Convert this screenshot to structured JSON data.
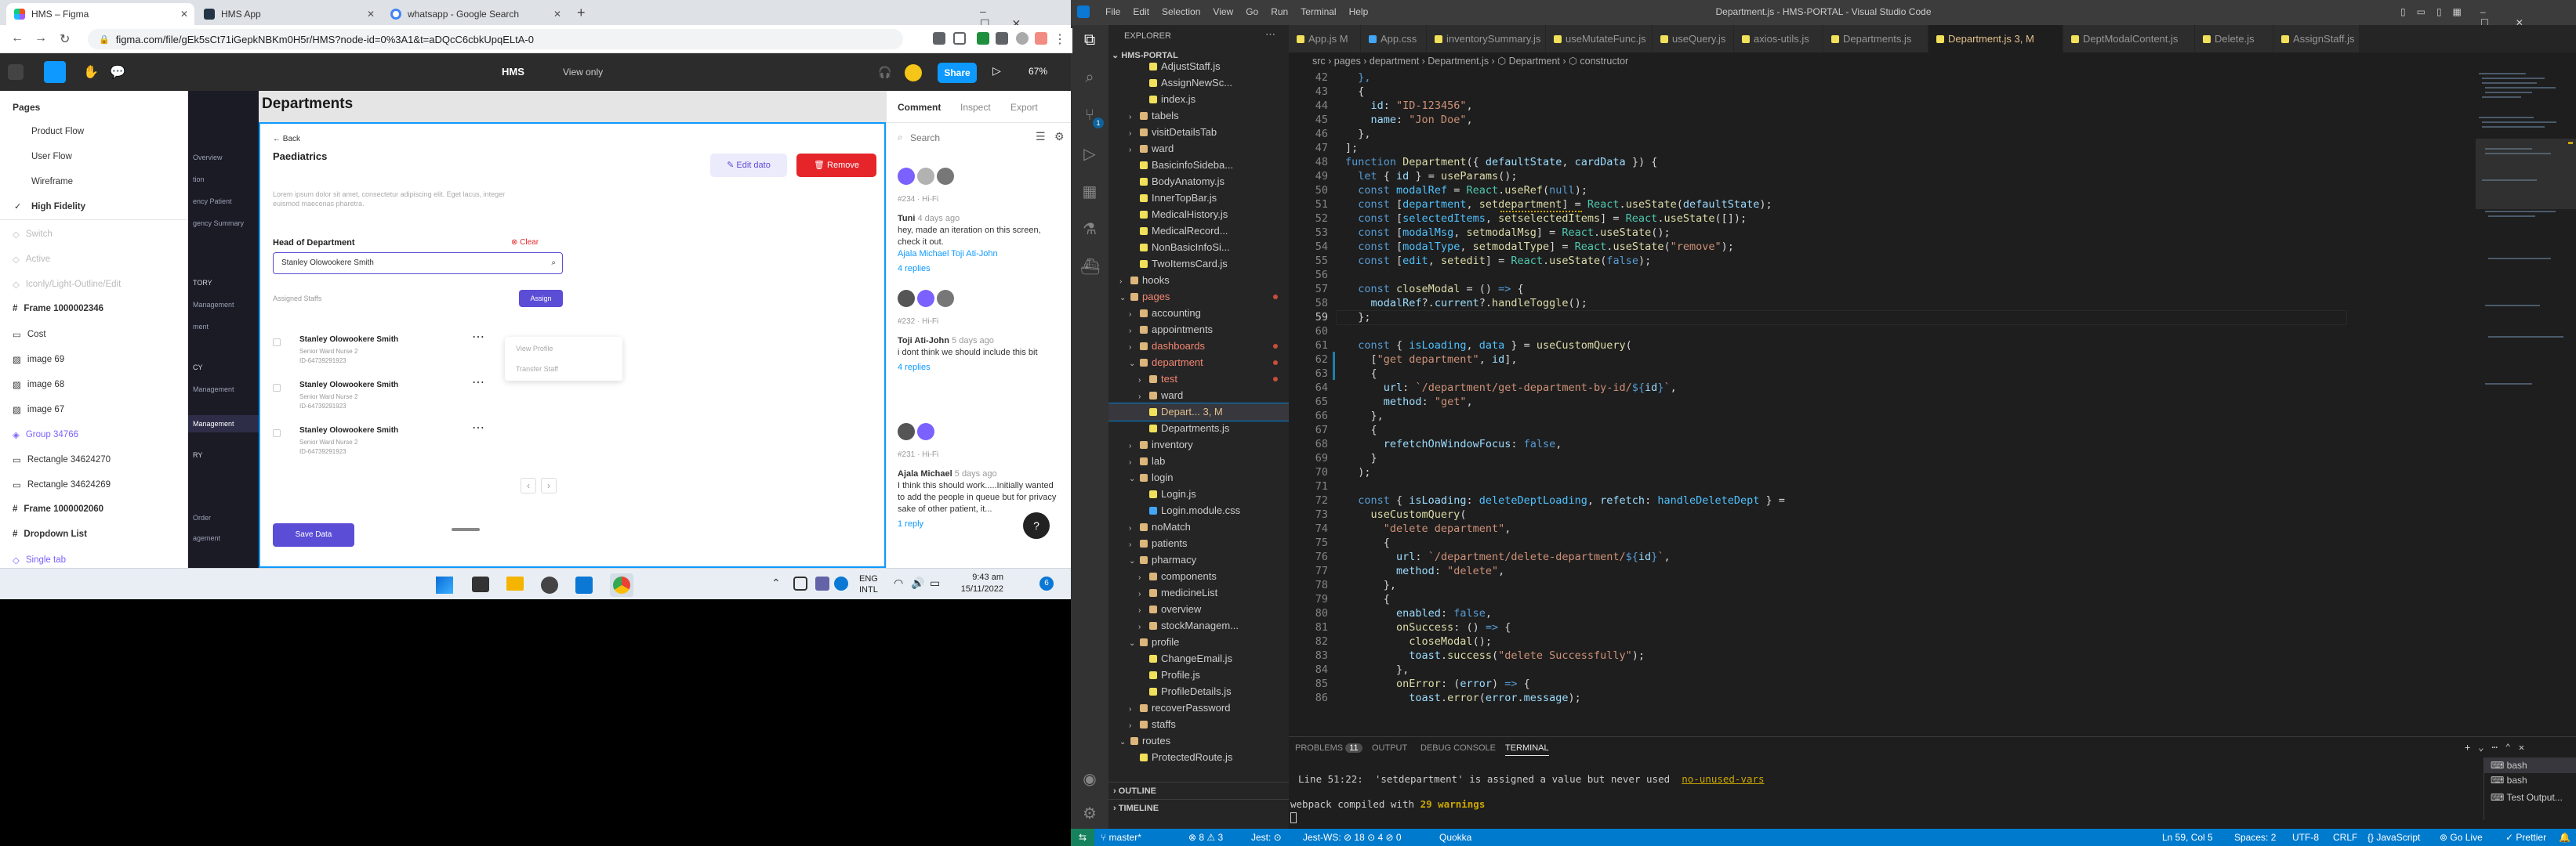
{
  "chrome": {
    "tabs": [
      {
        "label": "HMS – Figma",
        "active": true,
        "color": "#1e1e1e"
      },
      {
        "label": "HMS App",
        "active": false,
        "color": "#243447"
      },
      {
        "label": "whatsapp - Google Search",
        "active": false,
        "color": "#4285f4"
      }
    ],
    "new_tab": "+",
    "url": "figma.com/file/gEk5sCt71iGepkNBKm0H5r/HMS?node-id=0%3A1&t=aDQcC6cbkUpqELtA-0"
  },
  "figma_toolbar": {
    "file_name": "HMS",
    "view_only": "View only",
    "share": "Share",
    "zoom": "67%",
    "accent": "#0d99ff"
  },
  "figma_left": {
    "pages_header": "Pages",
    "pages": [
      "Product Flow",
      "User Flow",
      "Wireframe",
      "High Fidelity"
    ],
    "active_page": "High Fidelity",
    "layers": [
      {
        "label": "Switch",
        "muted": true
      },
      {
        "label": "Active",
        "muted": true
      },
      {
        "label": "Iconly/Light-Outline/Edit",
        "muted": true
      },
      {
        "label": "Frame 1000002346",
        "muted": false,
        "bold": true
      },
      {
        "label": "Cost",
        "muted": false
      },
      {
        "label": "image 69",
        "muted": false
      },
      {
        "label": "image 68",
        "muted": false
      },
      {
        "label": "image 67",
        "muted": false
      },
      {
        "label": "Group 34766",
        "muted": false,
        "blue": true
      },
      {
        "label": "Rectangle 34624270",
        "muted": false
      },
      {
        "label": "Rectangle 34624269",
        "muted": false
      },
      {
        "label": "Frame 1000002060",
        "muted": false,
        "bold": true
      },
      {
        "label": "Dropdown List",
        "muted": false,
        "bold": true
      },
      {
        "label": "Single tab",
        "muted": false,
        "blue": true
      }
    ]
  },
  "figma_canvas": {
    "side_nav": [
      "Overview",
      "tion",
      "ency Patient",
      "gency Summary",
      "TORY",
      "Management",
      "ment",
      "CY",
      "Management",
      "Management",
      "RY",
      "Order",
      "agement"
    ],
    "page_title": "Departments",
    "back": "Back",
    "dept_name": "Paediatrics",
    "lorem": "Lorem ipsum dolor sit amet, consectetur adipiscing elit. Eget lacus, integer euismod maecenas pharetra.",
    "edit_btn": "Edit dato",
    "remove_btn": "Remove",
    "head_label": "Head of Department",
    "clear": "Clear",
    "head_value": "Stanley Olowookere Smith",
    "assigned_label": "Assigned Staffs",
    "assign_btn": "Assign",
    "staff": [
      {
        "name": "Stanley Olowookere Smith",
        "role": "Senior Ward Nurse 2",
        "id": "ID-64739291923"
      },
      {
        "name": "Stanley Olowookere Smith",
        "role": "Senior Ward Nurse 2",
        "id": "ID-64739291923"
      },
      {
        "name": "Stanley Olowookere Smith",
        "role": "Senior Ward Nurse 2",
        "id": "ID-64739291923"
      }
    ],
    "menu": [
      "View Profile",
      "Transfer Staff"
    ],
    "pager": [
      "‹",
      "›"
    ],
    "save": "Save Data",
    "brand_red": "#e5252a",
    "brand_purple": "#5b4dd6"
  },
  "figma_right": {
    "tabs": [
      "Comment",
      "Inspect",
      "Export"
    ],
    "search_placeholder": "Search",
    "comments": [
      {
        "ref": "#234 · Hi-Fi",
        "author": "Tuni",
        "time": "4 days ago",
        "text": "hey, made an iteration on this screen, check it out.",
        "mention": "Ajala Michael Toji Ati-John",
        "replies": "4 replies"
      },
      {
        "ref": "#232 · Hi-Fi",
        "author": "Toji Ati-John",
        "time": "5 days ago",
        "text": "i dont think we should include this bit",
        "mention": "",
        "replies": "4 replies"
      },
      {
        "ref": "#231 · Hi-Fi",
        "author": "Ajala Michael",
        "time": "5 days ago",
        "text": "I think this should work.....Initially wanted to add the people in queue but for privacy sake of other patient, it...",
        "mention": "",
        "replies": "1 reply"
      }
    ],
    "help": "?"
  },
  "taskbar": {
    "lang": "ENG",
    "lang2": "INTL",
    "time": "9:43 am",
    "date": "15/11/2022",
    "badge": "6"
  },
  "vscode": {
    "menu": [
      "File",
      "Edit",
      "Selection",
      "View",
      "Go",
      "Run",
      "Terminal",
      "Help"
    ],
    "title": "Department.js - HMS-PORTAL - Visual Studio Code",
    "explorer_title": "EXPLORER",
    "root": "HMS-PORTAL",
    "tree": [
      {
        "label": "AdjustStaff.js",
        "indent": 3,
        "kind": "file",
        "color": "#f1e05a"
      },
      {
        "label": "AssignNewSc...",
        "indent": 3,
        "kind": "file",
        "color": "#f1e05a"
      },
      {
        "label": "index.js",
        "indent": 3,
        "kind": "file",
        "color": "#f1e05a"
      },
      {
        "label": "tabels",
        "indent": 2,
        "kind": "folder"
      },
      {
        "label": "visitDetailsTab",
        "indent": 2,
        "kind": "folder"
      },
      {
        "label": "ward",
        "indent": 2,
        "kind": "folder"
      },
      {
        "label": "BasicinfoSideba...",
        "indent": 2,
        "kind": "file",
        "color": "#f1e05a"
      },
      {
        "label": "BodyAnatomy.js",
        "indent": 2,
        "kind": "file",
        "color": "#f1e05a"
      },
      {
        "label": "InnerTopBar.js",
        "indent": 2,
        "kind": "file",
        "color": "#f1e05a"
      },
      {
        "label": "MedicalHistory.js",
        "indent": 2,
        "kind": "file",
        "color": "#f1e05a"
      },
      {
        "label": "MedicalRecord...",
        "indent": 2,
        "kind": "file",
        "color": "#f1e05a"
      },
      {
        "label": "NonBasicInfoSi...",
        "indent": 2,
        "kind": "file",
        "color": "#f1e05a"
      },
      {
        "label": "TwoItemsCard.js",
        "indent": 2,
        "kind": "file",
        "color": "#f1e05a"
      },
      {
        "label": "hooks",
        "indent": 1,
        "kind": "folder"
      },
      {
        "label": "pages",
        "indent": 1,
        "kind": "folder-open",
        "red": true
      },
      {
        "label": "accounting",
        "indent": 2,
        "kind": "folder"
      },
      {
        "label": "appointments",
        "indent": 2,
        "kind": "folder"
      },
      {
        "label": "dashboards",
        "indent": 2,
        "kind": "folder",
        "red": true
      },
      {
        "label": "department",
        "indent": 2,
        "kind": "folder-open",
        "red": true
      },
      {
        "label": "test",
        "indent": 3,
        "kind": "folder",
        "red": true
      },
      {
        "label": "ward",
        "indent": 3,
        "kind": "folder"
      },
      {
        "label": "Depart...  3, M",
        "indent": 3,
        "kind": "file",
        "color": "#f1e05a",
        "selected": true
      },
      {
        "label": "Departments.js",
        "indent": 3,
        "kind": "file",
        "color": "#f1e05a"
      },
      {
        "label": "inventory",
        "indent": 2,
        "kind": "folder"
      },
      {
        "label": "lab",
        "indent": 2,
        "kind": "folder"
      },
      {
        "label": "login",
        "indent": 2,
        "kind": "folder-open"
      },
      {
        "label": "Login.js",
        "indent": 3,
        "kind": "file",
        "color": "#f1e05a"
      },
      {
        "label": "Login.module.css",
        "indent": 3,
        "kind": "file",
        "color": "#42a5f5"
      },
      {
        "label": "noMatch",
        "indent": 2,
        "kind": "folder"
      },
      {
        "label": "patients",
        "indent": 2,
        "kind": "folder"
      },
      {
        "label": "pharmacy",
        "indent": 2,
        "kind": "folder-open"
      },
      {
        "label": "components",
        "indent": 3,
        "kind": "folder"
      },
      {
        "label": "medicineList",
        "indent": 3,
        "kind": "folder"
      },
      {
        "label": "overview",
        "indent": 3,
        "kind": "folder"
      },
      {
        "label": "stockManagem...",
        "indent": 3,
        "kind": "folder"
      },
      {
        "label": "profile",
        "indent": 2,
        "kind": "folder-open"
      },
      {
        "label": "ChangeEmail.js",
        "indent": 3,
        "kind": "file",
        "color": "#f1e05a"
      },
      {
        "label": "Profile.js",
        "indent": 3,
        "kind": "file",
        "color": "#f1e05a"
      },
      {
        "label": "ProfileDetails.js",
        "indent": 3,
        "kind": "file",
        "color": "#f1e05a"
      },
      {
        "label": "recoverPassword",
        "indent": 2,
        "kind": "folder"
      },
      {
        "label": "staffs",
        "indent": 2,
        "kind": "folder"
      },
      {
        "label": "routes",
        "indent": 1,
        "kind": "folder-open"
      },
      {
        "label": "ProtectedRoute.js",
        "indent": 2,
        "kind": "file",
        "color": "#f1e05a"
      }
    ],
    "outline": "OUTLINE",
    "timeline": "TIMELINE",
    "tabs": [
      {
        "label": "App.js  M",
        "color": "#f1e05a"
      },
      {
        "label": "App.css",
        "color": "#42a5f5"
      },
      {
        "label": "inventorySummary.js",
        "color": "#f1e05a"
      },
      {
        "label": "useMutateFunc.js",
        "color": "#f1e05a"
      },
      {
        "label": "useQuery.js",
        "color": "#f1e05a"
      },
      {
        "label": "axios-utils.js",
        "color": "#f1e05a"
      },
      {
        "label": "Departments.js",
        "color": "#f1e05a"
      },
      {
        "label": "Department.js  3, M",
        "color": "#f1e05a",
        "active": true
      },
      {
        "label": "DeptModalContent.js",
        "color": "#f1e05a"
      },
      {
        "label": "Delete.js",
        "color": "#f1e05a"
      },
      {
        "label": "AssignStaff.js",
        "color": "#f1e05a"
      }
    ],
    "breadcrumb": "src › pages › department › Department.js › ⬡ Department › ⬡ constructor",
    "code": [
      {
        "n": "42",
        "html": "  <span class='k'>},</span>"
      },
      {
        "n": "43",
        "html": "  {"
      },
      {
        "n": "44",
        "html": "    <span class='v'>id</span>: <span class='s'>\"ID-123456\"</span>,"
      },
      {
        "n": "45",
        "html": "    <span class='v'>name</span>: <span class='s'>\"Jon Doe\"</span>,"
      },
      {
        "n": "46",
        "html": "  },"
      },
      {
        "n": "47",
        "html": "];"
      },
      {
        "n": "48",
        "html": "<span class='k'>function</span> <span class='f'>Department</span>({ <span class='v'>defaultState</span>, <span class='v'>cardData</span> }) {"
      },
      {
        "n": "49",
        "html": "  <span class='k'>let</span> { <span class='v'>id</span> } = <span class='f'>useParams</span>();"
      },
      {
        "n": "50",
        "html": "  <span class='k'>const</span> <span class='c'>modalRef</span> = <span class='t'>React</span>.<span class='f'>useRef</span>(<span class='k'>null</span>);"
      },
      {
        "n": "51",
        "html": "  <span class='k'>const</span> [<span class='c'>department</span>, <span class='f'>setdepartment</span>] = <span class='t'>React</span>.<span class='f'>useState</span>(<span class='v'>defaultState</span>);"
      },
      {
        "n": "52",
        "html": "  <span class='k'>const</span> [<span class='c'>selectedItems</span>, <span class='f'>setselectedItems</span>] = <span class='t'>React</span>.<span class='f'>useState</span>([]);"
      },
      {
        "n": "53",
        "html": "  <span class='k'>const</span> [<span class='c'>modalMsg</span>, <span class='f'>setmodalMsg</span>] = <span class='t'>React</span>.<span class='f'>useState</span>();"
      },
      {
        "n": "54",
        "html": "  <span class='k'>const</span> [<span class='c'>modalType</span>, <span class='f'>setmodalType</span>] = <span class='t'>React</span>.<span class='f'>useState</span>(<span class='s'>\"remove\"</span>);"
      },
      {
        "n": "55",
        "html": "  <span class='k'>const</span> [<span class='c'>edit</span>, <span class='f'>setedit</span>] = <span class='t'>React</span>.<span class='f'>useState</span>(<span class='k'>false</span>);"
      },
      {
        "n": "56",
        "html": ""
      },
      {
        "n": "57",
        "html": "  <span class='k'>const</span> <span class='f'>closeModal</span> = () <span class='k'>=&gt;</span> {"
      },
      {
        "n": "58",
        "html": "    <span class='v'>modalRef</span>?.<span class='v'>current</span>?.<span class='f'>handleToggle</span>();"
      },
      {
        "n": "59",
        "html": "  };"
      },
      {
        "n": "60",
        "html": ""
      },
      {
        "n": "61",
        "html": "  <span class='k'>const</span> { <span class='c'>isLoading</span>, <span class='c'>data</span> } = <span class='f'>useCustomQuery</span>("
      },
      {
        "n": "62",
        "html": "    [<span class='s'>\"get department\"</span>, <span class='v'>id</span>],"
      },
      {
        "n": "63",
        "html": "    {"
      },
      {
        "n": "64",
        "html": "      <span class='v'>url</span>: <span class='s'>`/department/get-department-by-id/</span><span class='k'>${</span><span class='v'>id</span><span class='k'>}</span><span class='s'>`</span>,"
      },
      {
        "n": "65",
        "html": "      <span class='v'>method</span>: <span class='s'>\"get\"</span>,"
      },
      {
        "n": "66",
        "html": "    },"
      },
      {
        "n": "67",
        "html": "    {"
      },
      {
        "n": "68",
        "html": "      <span class='v'>refetchOnWindowFocus</span>: <span class='k'>false</span>,"
      },
      {
        "n": "69",
        "html": "    }"
      },
      {
        "n": "70",
        "html": "  );"
      },
      {
        "n": "71",
        "html": ""
      },
      {
        "n": "72",
        "html": "  <span class='k'>const</span> { <span class='v'>isLoading</span>: <span class='c'>deleteDeptLoading</span>, <span class='v'>refetch</span>: <span class='c'>handleDeleteDept</span> } ="
      },
      {
        "n": "73",
        "html": "    <span class='f'>useCustomQuery</span>("
      },
      {
        "n": "74",
        "html": "      <span class='s'>\"delete department\"</span>,"
      },
      {
        "n": "75",
        "html": "      {"
      },
      {
        "n": "76",
        "html": "        <span class='v'>url</span>: <span class='s'>`/department/delete-department/</span><span class='k'>${</span><span class='v'>id</span><span class='k'>}</span><span class='s'>`</span>,"
      },
      {
        "n": "77",
        "html": "        <span class='v'>method</span>: <span class='s'>\"delete\"</span>,"
      },
      {
        "n": "78",
        "html": "      },"
      },
      {
        "n": "79",
        "html": "      {"
      },
      {
        "n": "80",
        "html": "        <span class='v'>enabled</span>: <span class='k'>false</span>,"
      },
      {
        "n": "81",
        "html": "        <span class='f'>onSuccess</span>: () <span class='k'>=&gt;</span> {"
      },
      {
        "n": "82",
        "html": "          <span class='f'>closeModal</span>();"
      },
      {
        "n": "83",
        "html": "          <span class='v'>toast</span>.<span class='f'>success</span>(<span class='s'>\"delete Successfully\"</span>);"
      },
      {
        "n": "84",
        "html": "        },"
      },
      {
        "n": "85",
        "html": "        <span class='f'>onError</span>: (<span class='v'>error</span>) <span class='k'>=&gt;</span> {"
      },
      {
        "n": "86",
        "html": "          <span class='v'>toast</span>.<span class='f'>error</span>(<span class='v'>error</span>.<span class='v'>message</span>);"
      }
    ],
    "panel_tabs": [
      "PROBLEMS",
      "OUTPUT",
      "DEBUG CONSOLE",
      "TERMINAL"
    ],
    "problems_count": "11",
    "terminal": {
      "warning_line": "Line 51:22:  'setdepartment' is assigned a value but never used",
      "rule": "no-unused-vars",
      "compiled": "webpack compiled with ",
      "warnings": "29 warnings"
    },
    "terminals": [
      "bash",
      "bash",
      "Test Output..."
    ],
    "status": {
      "branch": "master*",
      "problems": "⊗ 8 ⚠ 3",
      "jest": "Jest: ⊙",
      "jestws": "Jest-WS: ⊘ 18 ⊙ 4 ⊘ 0",
      "quokka": "Quokka",
      "pos": "Ln 59, Col 5",
      "spaces": "Spaces: 2",
      "enc": "UTF-8",
      "eol": "CRLF",
      "lang": "{} JavaScript",
      "golive": "⊚ Go Live",
      "prettier": "✓ Prettier"
    }
  }
}
